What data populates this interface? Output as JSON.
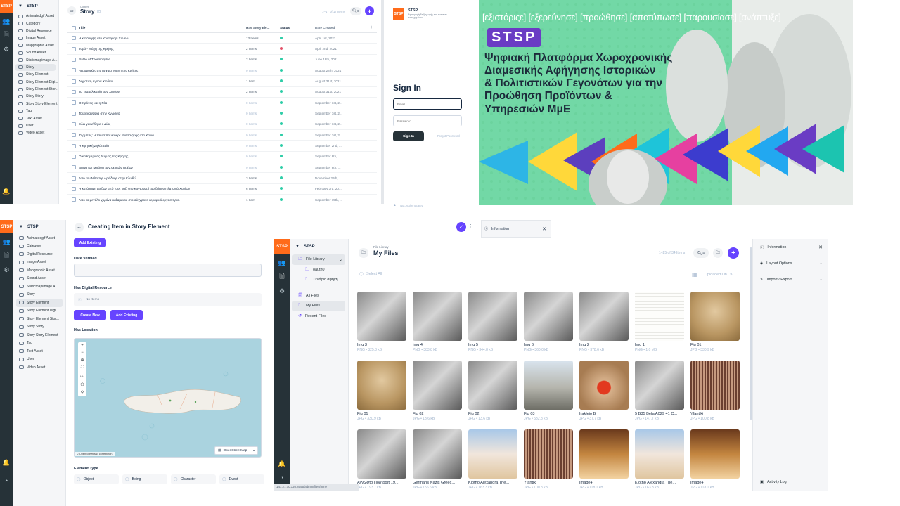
{
  "p1": {
    "brand": "STSP",
    "nav_items": [
      "Animatedgif Asset",
      "Category",
      "Digital Resource",
      "Image Asset",
      "Mapgraphic Asset",
      "Sound Asset",
      "Staticmapimage A...",
      "Story",
      "Story Element",
      "Story Element Digi...",
      "Story Element Stor...",
      "Story Story",
      "Story Story Element",
      "Tag",
      "Text Asset",
      "User",
      "Video Asset"
    ],
    "active_nav": 7,
    "crumb": "Content",
    "title": "Story",
    "count": "1–17 of 17 Items",
    "columns": [
      "Title",
      "Has Story Ele...",
      "Status",
      "Date Created"
    ],
    "rows": [
      {
        "title": "Η κατάληψη στο Κοντομαρί Χανίων",
        "items": "13 Items",
        "status": "#2ecda7",
        "date": "April 1st, 2021"
      },
      {
        "title": "Τυρό - Μάχη της Κρήτης",
        "items": "2 Items",
        "status": "#e35169",
        "date": "April 2nd, 2021"
      },
      {
        "title": "Battle of Thermopylae",
        "items": "2 Items",
        "status": "#2ecda7",
        "date": "June 18th, 2021"
      },
      {
        "title": "Αεροφορά στην αρχαιοί Μάχη της Κρήτης",
        "items": "0 Items",
        "status": "#2ecda7",
        "date": "August 28th, 2021"
      },
      {
        "title": "Δημοτική Αγορά Χανίων",
        "items": "1 Item",
        "status": "#2ecda7",
        "date": "August 31st, 2021"
      },
      {
        "title": "Τα Τεμπέλικαρία των Χανίων",
        "items": "2 Items",
        "status": "#2ecda7",
        "date": "August 31st, 2021"
      },
      {
        "title": "Ο Κρόνος και η Ρέα",
        "items": "0 Items",
        "status": "#2ecda7",
        "date": "September 1st, 2..."
      },
      {
        "title": "Ταυρεκαθάψια στην Κνωσσό",
        "items": "0 Items",
        "status": "#2ecda7",
        "date": "September 1st, 2..."
      },
      {
        "title": "Εδώ γεννήθηκε ο Δίας",
        "items": "0 Items",
        "status": "#2ecda7",
        "date": "September 1st, 2..."
      },
      {
        "title": "Ζορμπάς: Η ταινία που έφερε ανάσα ζωής στα Χανιά",
        "items": "0 Items",
        "status": "#2ecda7",
        "date": "September 1st, 2..."
      },
      {
        "title": "Η Κρητική Ζηλότοπία",
        "items": "0 Items",
        "status": "#2ecda7",
        "date": "September 2nd, ..."
      },
      {
        "title": "Ο καθημερινός Λύχνος της Κρήτης",
        "items": "0 Items",
        "status": "#2ecda7",
        "date": "September 8th, ..."
      },
      {
        "title": "Βάιμα και Μπόστι των Λευκών Ορέων",
        "items": "0 Items",
        "status": "#2ecda7",
        "date": "September 8th, ..."
      },
      {
        "title": "Απο τον Μίτο της Αριάδνης στην Κλωθώ..",
        "items": "3 Items",
        "status": "#2ecda7",
        "date": "November 29th, ..."
      },
      {
        "title": "Η κατάληψη αρίζων από τους ναζί στο Κοντομαρί του δήμου Πλατανιά Χανίων",
        "items": "6 Items",
        "status": "#2ecda7",
        "date": "February 3rd, 20..."
      },
      {
        "title": "Από το μεγάλο χορόνα-κάξαμενος στο σύγχρονο κεραμικό εργαστήριο.",
        "items": "1 Item",
        "status": "#2ecda7",
        "date": "September 15th, ..."
      }
    ]
  },
  "login": {
    "brand": "STSP",
    "brand_sub": "Εφαρμογή διεξαγωγής του τοπικού περιεχομένου",
    "title": "Sign In",
    "email_placeholder": "Email",
    "password_placeholder": "Password",
    "submit": "Sign In",
    "forgot": "Forgot Password",
    "footer": "Not Authenticated"
  },
  "hero": {
    "tagline": "[εξιστόριςε] [εξερεύνησε] [προώθησε] [αποτύπωσε] [παρουσίασε] [ανάπτυξε]",
    "logo": "STSP",
    "headline_l1": "Ψηφιακή Πλατφόρμα Χωροχρονικής",
    "headline_l2": "Διαμεσικής Αφήγησης Ιστορικών",
    "headline_l3": "& Πολιτιστικών Γεγονότων για την",
    "headline_l4": "Προώθηση Προϊόντων &",
    "headline_l5": "Υπηρεσιών ΜμΕ"
  },
  "p3": {
    "brand": "STSP",
    "title": "Creating Item in Story Element",
    "info": "Information",
    "add_existing": "Add Existing",
    "date_verified": "Date Verified",
    "has_digital_resource": "Has Digital Resource",
    "no_items": "No Items",
    "create_new": "Create New",
    "has_location": "Has Location",
    "map_attrib": "© OpenStreetMap contributors",
    "map_layer": "OpenStreetMap",
    "element_type": "Element Type",
    "types": [
      "Object",
      "Being",
      "Character",
      "Event"
    ],
    "nav_items": [
      "Animatedgif Asset",
      "Category",
      "Digital Resource",
      "Image Asset",
      "Mapgraphic Asset",
      "Sound Asset",
      "Staticmapimage A...",
      "Story",
      "Story Element",
      "Story Element Digi...",
      "Story Element Stor...",
      "Story Story",
      "Story Story Element",
      "Tag",
      "Text Asset",
      "User",
      "Video Asset"
    ],
    "active_nav": 8
  },
  "p4": {
    "brand": "STSP",
    "crumb": "File Library",
    "title": "My Files",
    "count": "1–25 of 34 Items",
    "select_all": "Select All",
    "sort": "Uploaded On",
    "status_url": "147.27.70.120:8055/admin/files/mine",
    "nav": [
      {
        "label": "File Library",
        "icon": "folder-icon",
        "kind": "library"
      },
      {
        "label": "oauth0",
        "icon": "folder-icon",
        "kind": "sub"
      },
      {
        "label": "Σενάριο αφήγη...",
        "icon": "folder-icon",
        "kind": "sub"
      },
      {
        "label": "All Files",
        "icon": "files-icon",
        "kind": "top"
      },
      {
        "label": "My Files",
        "icon": "user-files-icon",
        "kind": "active"
      },
      {
        "label": "Recent Files",
        "icon": "history-icon",
        "kind": "top"
      }
    ],
    "panel": {
      "info": "Information",
      "layout": "Layout Options",
      "import": "Import / Export",
      "activity": "Activity Log"
    },
    "files": [
      {
        "name": "Img 3",
        "meta": "PNG • 325.8 kB",
        "tone": "bw"
      },
      {
        "name": "Img 4",
        "meta": "PNG • 383.8 kB",
        "tone": "bw"
      },
      {
        "name": "Img 5",
        "meta": "PNG • 344.8 kB",
        "tone": "bw"
      },
      {
        "name": "Img 6",
        "meta": "PNG • 360.0 kB",
        "tone": "bw"
      },
      {
        "name": "Img 2",
        "meta": "PNG • 378.6 kB",
        "tone": "bw"
      },
      {
        "name": "Img 1",
        "meta": "PNG • 1.0 MB",
        "tone": "doc"
      },
      {
        "name": "Fig 01",
        "meta": "JPG • 330.9 kB",
        "tone": "sepia"
      },
      {
        "name": "Fig 01",
        "meta": "JPG • 330.9 kB",
        "tone": "sepia"
      },
      {
        "name": "Fig 02",
        "meta": "JPG • 13.6 kB",
        "tone": "bw"
      },
      {
        "name": "Fig 02",
        "meta": "JPG • 13.6 kB",
        "tone": "bw"
      },
      {
        "name": "Fig 03",
        "meta": "JPG • 532.8 kB",
        "tone": "stone"
      },
      {
        "name": "Irakleio B",
        "meta": "JPG • 37.7 kB",
        "tone": "ball"
      },
      {
        "name": "5 B35 Befa A029 41 C...",
        "meta": "JPG • 147.7 kB",
        "tone": "bw"
      },
      {
        "name": "Yfantiki",
        "meta": "JPG • 100.8 kB",
        "tone": "loom"
      },
      {
        "name": "Άγνωστο Πορτραίτ 19...",
        "meta": "JPG • 193.7 kB",
        "tone": "bw"
      },
      {
        "name": "Germans Nazis Greec...",
        "meta": "JPG • 156.6 kB",
        "tone": "bw"
      },
      {
        "name": "Klotho Alexandra The...",
        "meta": "JPG • 163.3 kB",
        "tone": "person"
      },
      {
        "name": "Yfantiki",
        "meta": "JPG • 100.8 kB",
        "tone": "loom"
      },
      {
        "name": "Image4",
        "meta": "JPG • 118.1 kB",
        "tone": "room"
      },
      {
        "name": "Klotho Alexandra The...",
        "meta": "JPG • 163.3 kB",
        "tone": "person"
      },
      {
        "name": "Image4",
        "meta": "JPG • 118.1 kB",
        "tone": "room"
      }
    ]
  },
  "colors": {
    "accent": "#6644ff",
    "rail": "#263238",
    "logo": "#ff6b1a",
    "ok": "#2ecda7",
    "warn": "#e35169"
  }
}
